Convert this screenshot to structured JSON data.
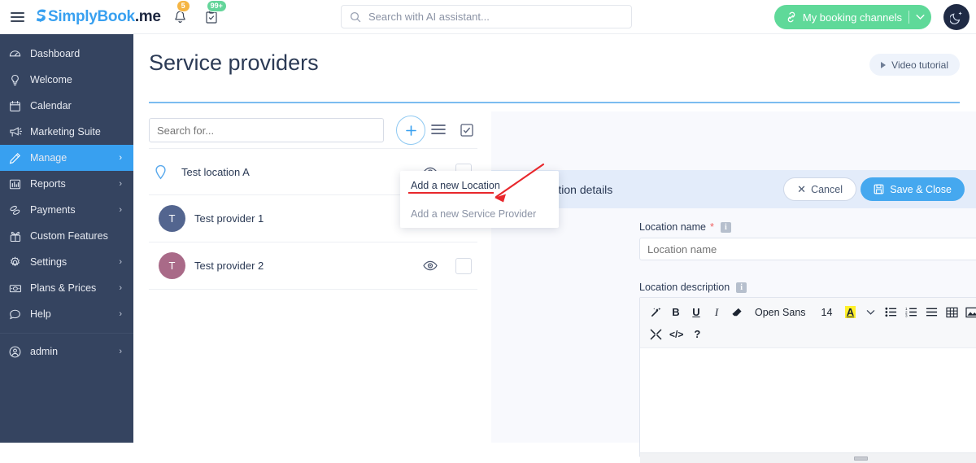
{
  "topbar": {
    "menu_icon": "hamburger-icon",
    "logo": {
      "blue_part": "SimplyBook",
      "dark_part": ".me"
    },
    "bell_icon": "bell-icon",
    "bell_badge": "5",
    "tasks_icon": "clipboard-check-icon",
    "tasks_badge": "99+",
    "search": {
      "placeholder": "Search with AI assistant...",
      "value": "",
      "icon": "search-icon"
    },
    "booking_button": {
      "label": "My booking channels",
      "icon": "link-icon",
      "caret": "∨",
      "color": "#5fd999"
    },
    "dark_mode_toggle": "moon-icon"
  },
  "sidebar": {
    "items": [
      {
        "label": "Dashboard",
        "icon": "gauge-icon",
        "arrow": "",
        "active": false
      },
      {
        "label": "Welcome",
        "icon": "lightbulb-icon",
        "arrow": "",
        "active": false
      },
      {
        "label": "Calendar",
        "icon": "calendar-icon",
        "arrow": "",
        "active": false
      },
      {
        "label": "Marketing Suite",
        "icon": "megaphone-icon",
        "arrow": "",
        "active": false
      },
      {
        "label": "Manage",
        "icon": "pencil-icon",
        "arrow": "›",
        "active": true
      },
      {
        "label": "Reports",
        "icon": "bar-chart-icon",
        "arrow": "›",
        "active": false
      },
      {
        "label": "Payments",
        "icon": "coins-icon",
        "arrow": "›",
        "active": false
      },
      {
        "label": "Custom Features",
        "icon": "gift-icon",
        "arrow": "",
        "active": false
      },
      {
        "label": "Settings",
        "icon": "gear-icon",
        "arrow": "›",
        "active": false
      },
      {
        "label": "Plans & Prices",
        "icon": "banknote-icon",
        "arrow": "›",
        "active": false
      },
      {
        "label": "Help",
        "icon": "chat-bubble-icon",
        "arrow": "›",
        "active": false
      }
    ],
    "account": {
      "label": "admin",
      "icon": "user-circle-icon",
      "arrow": "›"
    },
    "bg_color": "#354460",
    "active_color": "#38a0f0"
  },
  "page": {
    "title": "Service providers",
    "video_tutorial": {
      "label": "Video tutorial",
      "icon": "play-icon"
    },
    "rule_color": "#7bbcf0"
  },
  "list": {
    "search": {
      "placeholder": "Search for...",
      "value": ""
    },
    "add_button": {
      "icon": "plus-icon",
      "label": "+"
    },
    "list_view_icon": "list-lines-icon",
    "select_all_icon": "checkbox-checked-icon",
    "rows": [
      {
        "name": "Test location A",
        "type": "location",
        "icon": "map-pin-icon",
        "initial": "",
        "avatar_color": "#58a8ec",
        "eye_icon": "eye-icon",
        "checked": false
      },
      {
        "name": "Test provider 1",
        "type": "provider",
        "icon": "",
        "initial": "T",
        "avatar_color": "#53658f",
        "eye_icon": "eye-icon",
        "checked": false
      },
      {
        "name": "Test provider 2",
        "type": "provider",
        "icon": "",
        "initial": "T",
        "avatar_color": "#a96a88",
        "eye_icon": "eye-icon",
        "checked": false
      }
    ]
  },
  "dropdown": {
    "visible": true,
    "items": [
      {
        "label": "Add a new Location",
        "highlighted": true
      },
      {
        "label": "Add a new Service Provider",
        "highlighted": false
      }
    ],
    "annotation_color": "#e8272c"
  },
  "details_panel": {
    "header": {
      "title": "Location details",
      "icon": "sliders-icon"
    },
    "cancel_button": {
      "label": "Cancel",
      "icon": "x-icon"
    },
    "save_button": {
      "label": "Save & Close",
      "icon": "save-floppy-icon",
      "color": "#45a8ef"
    },
    "fields": {
      "location_name": {
        "label": "Location name",
        "required_marker": "*",
        "info_icon": "info-icon",
        "info_char": "i",
        "placeholder": "Location name",
        "value": ""
      },
      "location_description": {
        "label": "Location description",
        "info_icon": "info-icon",
        "info_char": "i",
        "value": ""
      }
    },
    "editor_toolbar": {
      "row1": [
        {
          "name": "magic-wand-icon",
          "glyph": "✨",
          "kind": "icon"
        },
        {
          "name": "bold-button",
          "glyph": "B",
          "kind": "bold"
        },
        {
          "name": "underline-button",
          "glyph": "U",
          "kind": "underline"
        },
        {
          "name": "italic-button",
          "glyph": "I",
          "kind": "italic"
        },
        {
          "name": "eraser-icon",
          "glyph": "█",
          "kind": "icon"
        },
        {
          "name": "font-family-select",
          "glyph": "Open Sans",
          "kind": "wide"
        },
        {
          "name": "font-size-select",
          "glyph": "14",
          "kind": "wide"
        },
        {
          "name": "text-color-button",
          "glyph": "A",
          "kind": "highlight"
        },
        {
          "name": "color-chevron-icon",
          "glyph": "∨",
          "kind": "icon"
        },
        {
          "name": "bullet-list-button",
          "glyph": "☰",
          "kind": "icon"
        },
        {
          "name": "numbered-list-button",
          "glyph": "☰",
          "kind": "icon"
        },
        {
          "name": "align-button",
          "glyph": "≡",
          "kind": "icon"
        },
        {
          "name": "table-button",
          "glyph": "▦",
          "kind": "icon"
        },
        {
          "name": "insert-image-button",
          "glyph": "⛰",
          "kind": "icon"
        },
        {
          "name": "insert-media-button",
          "glyph": "■",
          "kind": "icon"
        }
      ],
      "row2": [
        {
          "name": "fullscreen-button",
          "glyph": "⤢",
          "kind": "icon"
        },
        {
          "name": "source-code-button",
          "glyph": "</>",
          "kind": "code"
        },
        {
          "name": "help-button",
          "glyph": "?",
          "kind": "bold"
        }
      ]
    },
    "resize_handle": "resize-grip"
  }
}
